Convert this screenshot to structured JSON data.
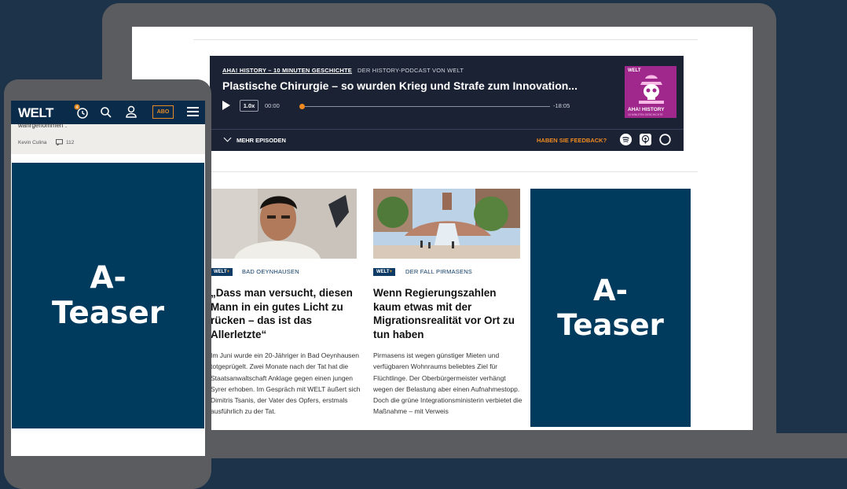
{
  "podcast": {
    "kicker": "AHA! HISTORY – 10 MINUTEN GESCHICHTE",
    "subtitle": "DER HISTORY-PODCAST VON WELT",
    "episode_title": "Plastische Chirurgie – so wurden Krieg und Strafe zum Innovation...",
    "speed": "1.0x",
    "time_current": "00:00",
    "time_remaining": "-18:05",
    "progress": 0,
    "cover_brand": "WELT",
    "cover_title": "AHA! HISTORY",
    "cover_sub": "10 MINUTEN GESCHICHTE",
    "more_episodes": "MEHR EPISODEN",
    "feedback": "HABEN SIE FEEDBACK?",
    "services": [
      "spotify-icon",
      "apple-podcasts-icon",
      "amazon-music-icon"
    ]
  },
  "articles": [
    {
      "badge_brand": "WELT",
      "badge_plus": "+",
      "kicker": "BAD OEYNHAUSEN",
      "headline": "„Dass man versucht, diesen Mann in ein gutes Licht zu rücken – das ist das Allerletzte“",
      "body": "Im Juni wurde ein 20-Jähriger in Bad Oeynhausen totgeprügelt. Zwei Monate nach der Tat hat die Staatsanwaltschaft Anklage gegen einen jungen Syrer erhoben. Im Gespräch mit WELT äußert sich Dimitris Tsanis, der Vater des Opfers, erstmals ausführlich zu der Tat."
    },
    {
      "badge_brand": "WELT",
      "badge_plus": "+",
      "kicker": "DER FALL PIRMASENS",
      "headline": "Wenn Regierungszahlen kaum etwas mit der Migrationsrealität vor Ort zu tun haben",
      "body": "Pirmasens ist wegen günstiger Mieten und verfügbaren Wohnraums beliebtes Ziel für Flüchtlinge. Der Oberbürgermeister verhängt wegen der Belastung aber einen Aufnahmestopp. Doch die grüne Integrationsministerin verbietet die Maßnahme – mit Verweis"
    }
  ],
  "ad_teaser": "A-\nTeaser",
  "phone": {
    "logo": "WELT",
    "notification_count": "4",
    "abo": "ABO",
    "prev_text": "wahrgenommen“.",
    "author": "Kevin Culina",
    "comment_count": "112",
    "ad_teaser": "A-\nTeaser"
  },
  "colors": {
    "background": "#1d3349",
    "player": "#1b2234",
    "accent": "#f08a1f",
    "teaser": "#003a5c",
    "brand": "#0b2b4a"
  }
}
